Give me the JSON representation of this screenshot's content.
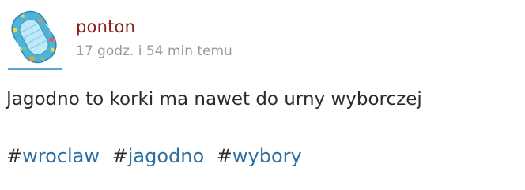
{
  "post": {
    "author": "ponton",
    "time_ago": "17 godz. i 54 min temu",
    "text": "Jagodno to korki ma nawet do urny wyborczej",
    "avatar_icon": "inflatable-boat-avatar",
    "tags": [
      {
        "hash": "#",
        "name": "wroclaw"
      },
      {
        "hash": "#",
        "name": "jagodno"
      },
      {
        "hash": "#",
        "name": "wybory"
      }
    ]
  },
  "colors": {
    "username": "#8b1a1a",
    "timestamp": "#9a9a9a",
    "tag": "#2d6fa3",
    "avatar_underline": "#5aa5d8"
  }
}
